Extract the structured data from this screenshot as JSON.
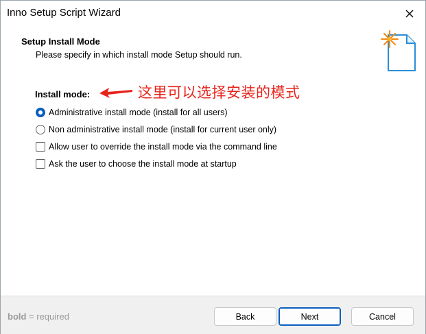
{
  "window": {
    "title": "Inno Setup Script Wizard",
    "close_icon": "close-icon"
  },
  "header": {
    "heading": "Setup Install Mode",
    "description": "Please specify in which install mode Setup should run.",
    "icon": "wizard-document-sparkle-icon"
  },
  "content": {
    "section_label": "Install mode:",
    "annotation": "这里可以选择安装的模式",
    "annotation_color": "#e8231b",
    "options": [
      {
        "type": "radio",
        "label": "Administrative install mode (install for all users)",
        "checked": true
      },
      {
        "type": "radio",
        "label": "Non administrative install mode (install for current user only)",
        "checked": false
      },
      {
        "type": "checkbox",
        "label": "Allow user to override the install mode via the command line",
        "checked": false
      },
      {
        "type": "checkbox",
        "label": "Ask the user to choose the install mode at startup",
        "checked": false
      }
    ]
  },
  "footer": {
    "hint_bold": "bold",
    "hint_rest": " = required",
    "back_label": "Back",
    "next_label": "Next",
    "cancel_label": "Cancel"
  },
  "colors": {
    "accent": "#0a5fbd",
    "footer_bg": "#f0f0f0"
  }
}
